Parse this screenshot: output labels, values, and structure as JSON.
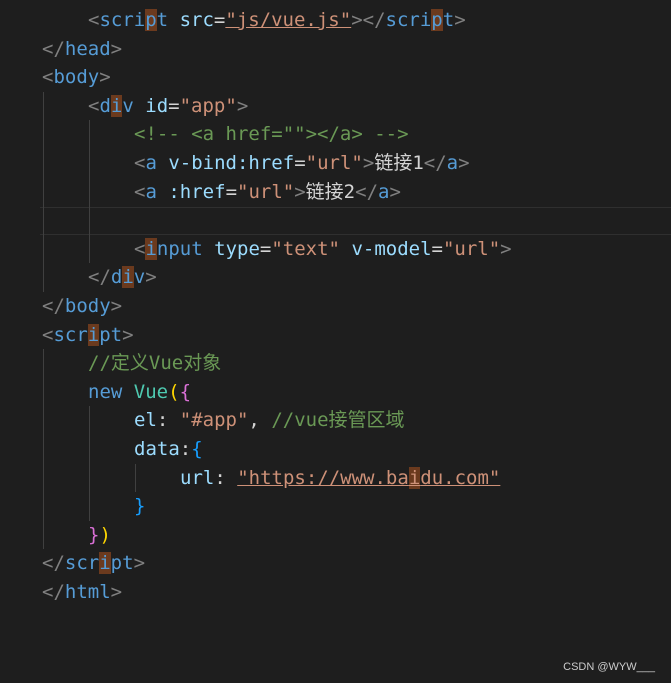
{
  "editor": {
    "line_numbers": [
      "",
      "",
      "",
      "",
      "",
      "",
      "",
      "",
      "",
      "",
      "",
      "",
      "",
      "",
      "",
      "",
      "",
      "",
      "",
      "",
      ""
    ],
    "lines": [
      {
        "indent": 2,
        "tokens": [
          {
            "t": "<",
            "c": "punc"
          },
          {
            "t": "script",
            "c": "tag",
            "hl": [
              4
            ]
          },
          {
            "t": " ",
            "c": "txt"
          },
          {
            "t": "src",
            "c": "attr"
          },
          {
            "t": "=",
            "c": "txt"
          },
          {
            "t": "\"js/vue.js\"",
            "c": "str",
            "ul": true
          },
          {
            "t": "></",
            "c": "punc"
          },
          {
            "t": "script",
            "c": "tag",
            "hl": [
              4
            ]
          },
          {
            "t": ">",
            "c": "punc"
          }
        ]
      },
      {
        "indent": 0,
        "tokens": [
          {
            "t": "</",
            "c": "punc"
          },
          {
            "t": "head",
            "c": "tag"
          },
          {
            "t": ">",
            "c": "punc"
          }
        ]
      },
      {
        "indent": 0,
        "tokens": [
          {
            "t": "<",
            "c": "punc"
          },
          {
            "t": "body",
            "c": "tag"
          },
          {
            "t": ">",
            "c": "punc"
          }
        ]
      },
      {
        "indent": 2,
        "tokens": [
          {
            "t": "<",
            "c": "punc"
          },
          {
            "t": "div",
            "c": "tag",
            "hl": [
              1
            ]
          },
          {
            "t": " ",
            "c": "txt"
          },
          {
            "t": "id",
            "c": "attr"
          },
          {
            "t": "=",
            "c": "txt"
          },
          {
            "t": "\"app\"",
            "c": "str"
          },
          {
            "t": ">",
            "c": "punc"
          }
        ]
      },
      {
        "indent": 4,
        "tokens": [
          {
            "t": "<!-- <a href=\"\"></a> -->",
            "c": "cmt"
          }
        ]
      },
      {
        "indent": 4,
        "tokens": [
          {
            "t": "<",
            "c": "punc"
          },
          {
            "t": "a",
            "c": "tag"
          },
          {
            "t": " ",
            "c": "txt"
          },
          {
            "t": "v-bind:href",
            "c": "attr"
          },
          {
            "t": "=",
            "c": "txt"
          },
          {
            "t": "\"url\"",
            "c": "str"
          },
          {
            "t": ">",
            "c": "punc"
          },
          {
            "t": "链接1",
            "c": "txt"
          },
          {
            "t": "</",
            "c": "punc"
          },
          {
            "t": "a",
            "c": "tag"
          },
          {
            "t": ">",
            "c": "punc"
          }
        ]
      },
      {
        "indent": 4,
        "tokens": [
          {
            "t": "<",
            "c": "punc"
          },
          {
            "t": "a",
            "c": "tag"
          },
          {
            "t": " ",
            "c": "txt"
          },
          {
            "t": ":href",
            "c": "attr"
          },
          {
            "t": "=",
            "c": "txt"
          },
          {
            "t": "\"url\"",
            "c": "str"
          },
          {
            "t": ">",
            "c": "punc"
          },
          {
            "t": "链接2",
            "c": "txt"
          },
          {
            "t": "</",
            "c": "punc"
          },
          {
            "t": "a",
            "c": "tag"
          },
          {
            "t": ">",
            "c": "punc"
          }
        ]
      },
      {
        "indent": 4,
        "tokens": []
      },
      {
        "indent": 4,
        "tokens": [
          {
            "t": "<",
            "c": "punc"
          },
          {
            "t": "input",
            "c": "tag",
            "hl": [
              0
            ]
          },
          {
            "t": " ",
            "c": "txt"
          },
          {
            "t": "type",
            "c": "attr"
          },
          {
            "t": "=",
            "c": "txt"
          },
          {
            "t": "\"text\"",
            "c": "str"
          },
          {
            "t": " ",
            "c": "txt"
          },
          {
            "t": "v-model",
            "c": "attr"
          },
          {
            "t": "=",
            "c": "txt"
          },
          {
            "t": "\"url\"",
            "c": "str"
          },
          {
            "t": ">",
            "c": "punc"
          }
        ]
      },
      {
        "indent": 2,
        "tokens": [
          {
            "t": "</",
            "c": "punc"
          },
          {
            "t": "div",
            "c": "tag",
            "hl": [
              1
            ]
          },
          {
            "t": ">",
            "c": "punc"
          }
        ]
      },
      {
        "indent": 0,
        "tokens": [
          {
            "t": "</",
            "c": "punc"
          },
          {
            "t": "body",
            "c": "tag"
          },
          {
            "t": ">",
            "c": "punc"
          }
        ]
      },
      {
        "indent": 0,
        "tokens": [
          {
            "t": "<",
            "c": "punc"
          },
          {
            "t": "script",
            "c": "tag",
            "hl": [
              3
            ]
          },
          {
            "t": ">",
            "c": "punc"
          }
        ]
      },
      {
        "indent": 2,
        "tokens": [
          {
            "t": "//定义Vue对象",
            "c": "cmt"
          }
        ]
      },
      {
        "indent": 2,
        "tokens": [
          {
            "t": "new",
            "c": "kw"
          },
          {
            "t": " ",
            "c": "txt"
          },
          {
            "t": "Vue",
            "c": "cls"
          },
          {
            "t": "(",
            "c": "brace-y"
          },
          {
            "t": "{",
            "c": "brace-p"
          }
        ]
      },
      {
        "indent": 4,
        "tokens": [
          {
            "t": "el",
            "c": "prop"
          },
          {
            "t": ": ",
            "c": "txt"
          },
          {
            "t": "\"#app\"",
            "c": "str"
          },
          {
            "t": ", ",
            "c": "txt"
          },
          {
            "t": "//vue接管区域",
            "c": "cmt"
          }
        ]
      },
      {
        "indent": 4,
        "tokens": [
          {
            "t": "data",
            "c": "prop"
          },
          {
            "t": ":",
            "c": "txt"
          },
          {
            "t": "{",
            "c": "brace-b"
          }
        ]
      },
      {
        "indent": 6,
        "tokens": [
          {
            "t": "url",
            "c": "prop"
          },
          {
            "t": ": ",
            "c": "txt"
          },
          {
            "t": "\"https://www.baidu.com\"",
            "c": "str",
            "ul": true,
            "hl": [
              15
            ]
          }
        ]
      },
      {
        "indent": 4,
        "tokens": [
          {
            "t": "}",
            "c": "brace-b"
          }
        ]
      },
      {
        "indent": 2,
        "tokens": [
          {
            "t": "}",
            "c": "brace-p"
          },
          {
            "t": ")",
            "c": "brace-y"
          }
        ]
      },
      {
        "indent": 0,
        "tokens": [
          {
            "t": "</",
            "c": "punc"
          },
          {
            "t": "script",
            "c": "tag",
            "hl": [
              3
            ]
          },
          {
            "t": ">",
            "c": "punc"
          }
        ]
      },
      {
        "indent": 0,
        "tokens": [
          {
            "t": "</",
            "c": "punc"
          },
          {
            "t": "html",
            "c": "tag"
          },
          {
            "t": ">",
            "c": "punc"
          }
        ]
      }
    ]
  },
  "watermark": "CSDN @WYW___"
}
